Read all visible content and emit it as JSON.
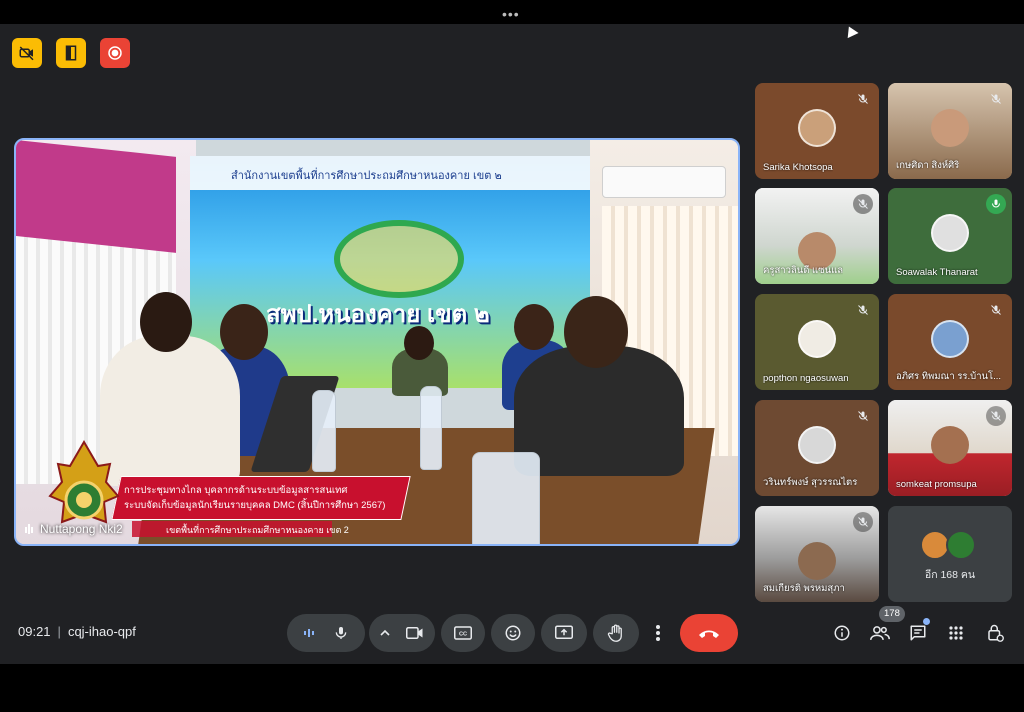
{
  "meeting": {
    "time": "09:21",
    "separator": "|",
    "code": "cqj-ihao-qpf",
    "participant_count": "178"
  },
  "presenter": {
    "name": "Nuttapong Nki2",
    "backdrop_org": "สำนักงานเขตพื้นที่การศึกษาประถมศึกษาหนองคาย เขต ๒",
    "backdrop_title": "สพป.หนองคาย เขต ๒",
    "lower_third": {
      "line1": "การประชุมทางไกล บุคลากรด้านระบบข้อมูลสารสนเทศ",
      "line2": "ระบบจัดเก็บข้อมูลนักเรียนรายบุคคล DMC (สิ้นปีการศึกษา 2567)",
      "line3": "เขตพื้นที่การศึกษาประถมศึกษาหนองคาย เขต 2"
    }
  },
  "participants": [
    {
      "name": "Sarika Khotsopa",
      "muted": true,
      "bg": "#7b4a2c"
    },
    {
      "name": "เกษศิดา สิงห์ศิริ",
      "muted": true,
      "bg": "#b79a7a"
    },
    {
      "name": "ครูสาวลินดี แซนแล",
      "muted": true,
      "bg": "#d9dde0"
    },
    {
      "name": "Soawalak Thanarat",
      "muted": false,
      "bg": "#3e6d3c"
    },
    {
      "name": "popthon ngaosuwan",
      "muted": true,
      "bg": "#5a5a30"
    },
    {
      "name": "อภิศร ทิพมณา รร.บ้านโ...",
      "muted": true,
      "bg": "#7a4a2c"
    },
    {
      "name": "วรินทร์พงษ์ สุวรรณไตร",
      "muted": true,
      "bg": "#6e4a32"
    },
    {
      "name": "somkeat promsupa",
      "muted": true,
      "bg": "#c9c4bc"
    },
    {
      "name": "สมเกียรติ พรหมสุภา",
      "muted": true,
      "bg": "#7d7b78"
    }
  ],
  "more_people": "อีก 168 คน",
  "colors": {
    "stage": "#202124",
    "control": "#3c4043",
    "end_call": "#ea4335",
    "indicator": "#fbbc04",
    "record": "#ea4335",
    "active_border": "#8ab4f8"
  },
  "icons": {
    "badges": [
      "camera-off-icon",
      "door-exit-icon",
      "record-icon"
    ],
    "controls": [
      "audio-levels-icon",
      "microphone-icon",
      "chevron-up-icon",
      "camera-icon",
      "captions-icon",
      "emoji-icon",
      "present-screen-icon",
      "raise-hand-icon",
      "more-vert-icon",
      "end-call-icon"
    ],
    "utilities": [
      "info-icon",
      "people-icon",
      "chat-icon",
      "activities-icon",
      "host-controls-icon"
    ]
  }
}
